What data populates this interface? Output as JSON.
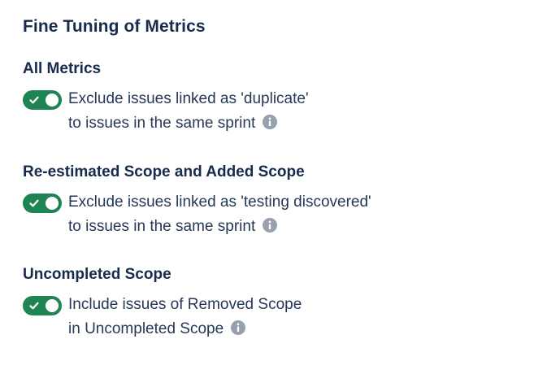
{
  "page": {
    "title": "Fine Tuning of Metrics"
  },
  "sections": [
    {
      "title": "All Metrics",
      "setting": {
        "enabled": true,
        "line1": "Exclude issues linked as 'duplicate'",
        "line2": "to issues in the same sprint"
      }
    },
    {
      "title": "Re-estimated Scope and Added Scope",
      "setting": {
        "enabled": true,
        "line1": "Exclude issues linked as 'testing discovered'",
        "line2": "to issues in the same sprint"
      }
    },
    {
      "title": "Uncompleted Scope",
      "setting": {
        "enabled": true,
        "line1": "Include issues of Removed Scope",
        "line2": "in Uncompleted Scope"
      }
    }
  ],
  "icons": {
    "toggle_check": "check-icon",
    "info": "info-icon"
  },
  "colors": {
    "toggle_on": "#1f8454",
    "heading_text": "#172b4d",
    "body_text": "#253858",
    "info_icon": "#97a0af"
  }
}
